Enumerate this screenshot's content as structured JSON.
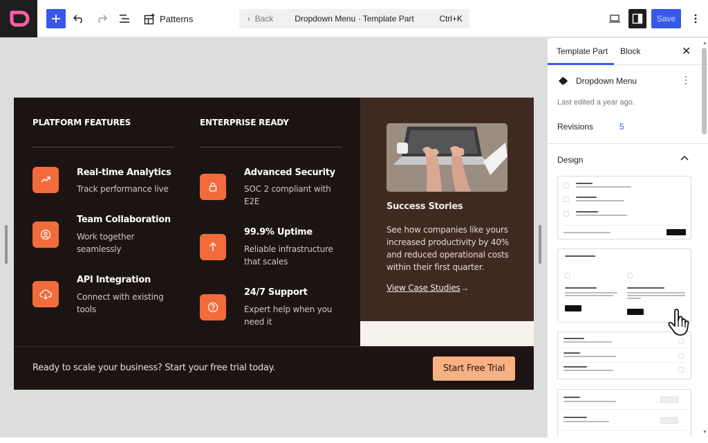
{
  "toolbar": {
    "patterns_label": "Patterns",
    "command": {
      "back": "Back",
      "title": "Dropdown Menu · Template Part",
      "shortcut": "Ctrl+K"
    },
    "save_label": "Save"
  },
  "canvas": {
    "columns": [
      {
        "heading": "PLATFORM FEATURES",
        "items": [
          {
            "icon": "trend-up-icon",
            "title": "Real-time Analytics",
            "desc": "Track performance live"
          },
          {
            "icon": "users-icon",
            "title": "Team Collaboration",
            "desc": "Work together seamlessly"
          },
          {
            "icon": "cloud-icon",
            "title": "API Integration",
            "desc": "Connect with existing tools"
          }
        ]
      },
      {
        "heading": "ENTERPRISE READY",
        "items": [
          {
            "icon": "lock-icon",
            "title": "Advanced Security",
            "desc": "SOC 2 compliant with E2E"
          },
          {
            "icon": "arrow-up-icon",
            "title": "99.9% Uptime",
            "desc": "Reliable infrastructure that scales"
          },
          {
            "icon": "help-icon",
            "title": "24/7 Support",
            "desc": "Expert help when you need it"
          }
        ]
      }
    ],
    "stories": {
      "title": "Success Stories",
      "desc": "See how companies like yours increased productivity by 40% and reduced operational costs within their first quarter.",
      "link": "View Case Studies",
      "arrow": "→"
    },
    "footer": {
      "text": "Ready to scale your business? Start your free trial today.",
      "cta": "Start Free Trial"
    }
  },
  "sidebar": {
    "tabs": [
      "Template Part",
      "Block"
    ],
    "block_name": "Dropdown Menu",
    "last_edited": "Last edited a year ago.",
    "revisions_label": "Revisions",
    "revisions_count": "5",
    "design_label": "Design"
  },
  "colors": {
    "accent": "#3858e9",
    "menu_bg": "#1c1412",
    "icon_orange": "#f26b3a",
    "cta_peach": "#f7b183",
    "panel_brown": "#3f2a22"
  }
}
